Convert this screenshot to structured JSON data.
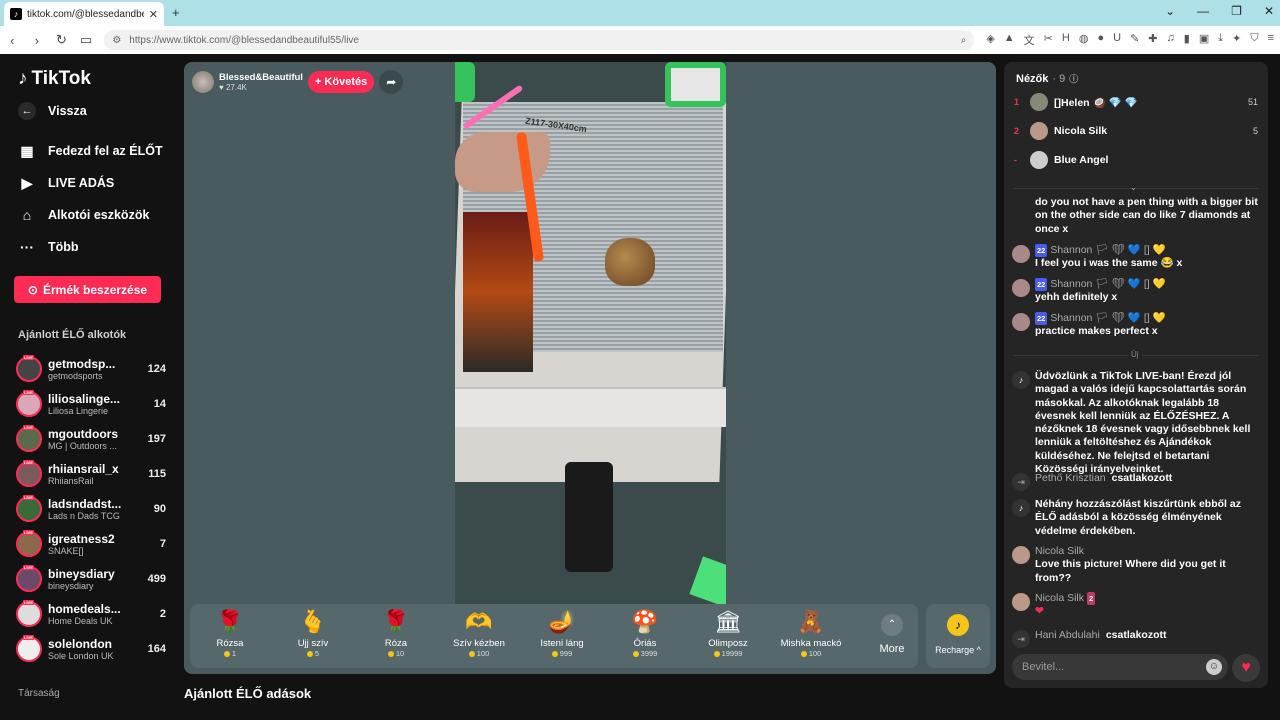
{
  "browser": {
    "tab_title": "tiktok.com/@blessedandbea...",
    "url": "https://www.tiktok.com/@blessedandbeautiful55/live",
    "win_min": "⌄",
    "win_min2": "—",
    "win_max": "❐",
    "win_close": "✕"
  },
  "sidebar": {
    "logo": "TikTok",
    "back": "Vissza",
    "nav": [
      {
        "label": "Fedezd fel az ÉLŐT",
        "icon": "calendar-icon"
      },
      {
        "label": "LIVE ADÁS",
        "icon": "camera-icon"
      },
      {
        "label": "Alkotói eszközök",
        "icon": "home-tools-icon"
      },
      {
        "label": "Több",
        "icon": "more-icon"
      }
    ],
    "coins_button": "Érmék beszerzése",
    "recommended_title": "Ajánlott ÉLŐ alkotók",
    "creators": [
      {
        "name": "getmodsp...",
        "sub": "getmodsports",
        "count": "124"
      },
      {
        "name": "liliosalinge...",
        "sub": "Liliosa Lingerie",
        "count": "14"
      },
      {
        "name": "mgoutdoors",
        "sub": "MG | Outdoors ...",
        "count": "197"
      },
      {
        "name": "rhiiansrail_x",
        "sub": "RhiiansRail",
        "count": "115"
      },
      {
        "name": "ladsndadst...",
        "sub": "Lads n Dads TCG",
        "count": "90"
      },
      {
        "name": "igreatness2",
        "sub": "SNAKE[]",
        "count": "7"
      },
      {
        "name": "bineysdiary",
        "sub": "bineysdiary",
        "count": "499"
      },
      {
        "name": "homedeals...",
        "sub": "Home Deals UK",
        "count": "2"
      },
      {
        "name": "solelondon",
        "sub": "Sole London UK",
        "count": "164"
      }
    ],
    "companies": "Társaság"
  },
  "stage": {
    "host_name": "Blessed&Beautiful",
    "host_followers": "♥ 27.4K",
    "follow_button": "+ Követés",
    "video_label": "Z117-30X40cm",
    "gifts": [
      {
        "name": "Rózsa",
        "price": "1",
        "icon": "🌹"
      },
      {
        "name": "Ujj szív",
        "price": "5",
        "icon": "🫰"
      },
      {
        "name": "Róza",
        "price": "10",
        "icon": "🌹"
      },
      {
        "name": "Szív kézben",
        "price": "100",
        "icon": "🫶"
      },
      {
        "name": "Isteni láng",
        "price": "999",
        "icon": "🪔"
      },
      {
        "name": "Óriás",
        "price": "3999",
        "icon": "🍄"
      },
      {
        "name": "Olimposz",
        "price": "19999",
        "icon": "🏛"
      },
      {
        "name": "Mishka mackó",
        "price": "100",
        "icon": "🧸"
      }
    ],
    "more_label": "More",
    "recharge_label": "Recharge ^",
    "recommended_lives": "Ajánlott ÉLŐ adások"
  },
  "chat": {
    "viewers_title": "Nézők",
    "viewers_count": "· 9",
    "viewers": [
      {
        "rank": "1",
        "name": "[]Helen 🥥 💎 💎",
        "score": "51"
      },
      {
        "rank": "2",
        "name": "Nicola Silk",
        "score": "5"
      },
      {
        "rank": "-",
        "name": "Blue Angel",
        "score": ""
      }
    ],
    "messages": [
      {
        "user": "",
        "badge": "",
        "text": "do you not have a pen thing with a bigger bit on the other side can do like 7 diamonds at once x"
      },
      {
        "user": "Shannon",
        "badge": "22",
        "extras": "🏳 ❤ 💙 [] 💛",
        "text": "I feel you i was the same 😂 x"
      },
      {
        "user": "Shannon",
        "badge": "22",
        "extras": "🏳 ❤ 💙 [] 💛",
        "text": "yehh definitely x"
      },
      {
        "user": "Shannon",
        "badge": "22",
        "extras": "🏳 ❤ 💙 [] 💛",
        "text": "practice makes perfect x"
      }
    ],
    "new_label": "Új",
    "system_welcome": "Üdvözlünk a TikTok LIVE-ban! Érezd jól magad a valós idejű kapcsolattartás során másokkal. Az alkotóknak legalább 18 évesnek kell lenniük az ÉLŐZÉSHEZ. A nézőknek 18 évesnek vagy idősebbnek kell lenniük a feltöltéshez és Ajándékok küldéséhez. Ne felejtsd el betartani Közösségi irányelveinket.",
    "join1_user": "Pethő Krisztian",
    "join1_text": "csatlakozott",
    "system_filter": "Néhány hozzászólást kiszűrtünk ebből az ÉLŐ adásból a közösség élményének védelme érdekében.",
    "msg_nicola1_user": "Nicola Silk",
    "msg_nicola1_text": "Love this picture! Where did you get it from??",
    "msg_nicola2_user": "Nicola Silk",
    "msg_nicola2_badge": "2",
    "msg_nicola2_text": "❤",
    "join2_user": "Hani Abdulahi",
    "join2_text": "csatlakozott",
    "input_placeholder": "Bevitel..."
  },
  "colors": {
    "accent": "#fe2c55",
    "stage_bg": "#495b5e",
    "chat_bg": "#252525"
  }
}
